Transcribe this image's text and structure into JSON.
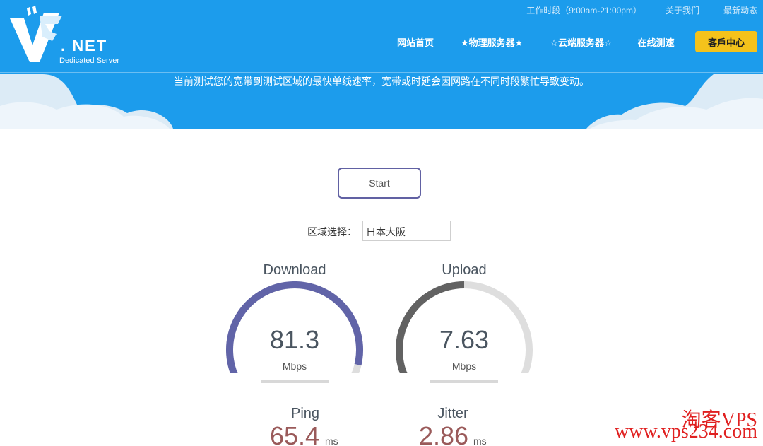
{
  "header": {
    "logo_net": ". NET",
    "logo_sub": "Dedicated Server",
    "topbar": {
      "hours": "工作时段（9:00am-21:00pm）",
      "about": "关于我们",
      "news": "最新动态"
    },
    "nav": {
      "home": "网站首页",
      "physical": "★物理服务器★",
      "cloud": "☆云端服务器☆",
      "speedtest": "在线测速",
      "client": "客戶中心"
    },
    "notice": "当前测试您的宽带到测试区域的最快单线速率，宽带或时延会因网路在不同时段繁忙导致变动。"
  },
  "test": {
    "start_label": "Start",
    "region_label": "区域选择：",
    "region_value": "日本大阪"
  },
  "gauges": {
    "download": {
      "title": "Download",
      "value": "81.3",
      "unit": "Mbps",
      "fill": 0.93,
      "color": "#6164a8"
    },
    "upload": {
      "title": "Upload",
      "value": "7.63",
      "unit": "Mbps",
      "fill": 0.5,
      "color": "#626262"
    }
  },
  "metrics": {
    "ping": {
      "title": "Ping",
      "value": "65.4",
      "unit": "ms"
    },
    "jitter": {
      "title": "Jitter",
      "value": "2.86",
      "unit": "ms"
    }
  },
  "watermark": {
    "line1": "淘客VPS",
    "line2": "www.vps234.com"
  },
  "colors": {
    "header_blue": "#1c9cec",
    "cta_yellow": "#f4c21b",
    "gauge_track": "#dedede",
    "metric_value": "#9a5a5a"
  }
}
